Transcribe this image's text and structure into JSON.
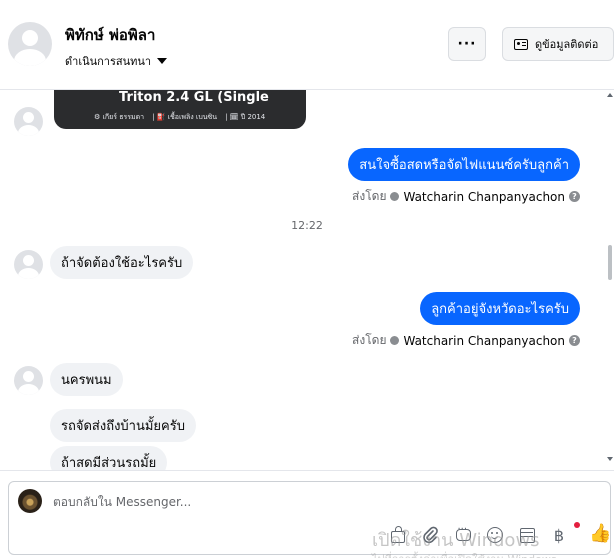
{
  "header": {
    "contact_name": "พิทักษ์ พ่อพิลา",
    "manage_chat_label": "ดำเนินการสนทนา",
    "more_label": "···",
    "contact_info_label": "ดูข้อมูลติดต่อ"
  },
  "messages": {
    "product_card": {
      "title": "Triton 2.4 GL (Single",
      "meta": [
        "⚙ เกียร์ ธรรมดา",
        "| ⛽ เชื้อเพลิง เบนซิน",
        "| 🗓 ปี 2014"
      ]
    },
    "out_1": "สนใจซื้อสดหรือจัดไฟแนนซ์ครับลูกค้า",
    "sent_by_prefix": "ส่งโดย",
    "sender_name": "Watcharin Chanpanyachon",
    "help_glyph": "?",
    "timestamp": "12:22",
    "in_1": "ถ้าจัดต้องใช้อะไรครับ",
    "out_2": "ลูกค้าอยู่จังหวัดอะไรครับ",
    "in_2": "นครพนม",
    "in_3": "รถจัดส่งถึงบ้านมั้ยครับ",
    "in_4": "ถ้าสดมีส่วนรถมั้ย"
  },
  "composer": {
    "placeholder": "ตอบกลับใน Messenger...",
    "icons": [
      "bag-icon",
      "paperclip-icon",
      "chat-icon",
      "smile-icon",
      "table-icon",
      "baht-icon",
      "like-icon"
    ]
  },
  "watermark": {
    "line1": "เปิดใช้งาน Windows",
    "line2": "ไปที่การตั้งค่าเพื่อเปิดใช้งาน Windows"
  },
  "colors": {
    "outgoing_bubble": "#0866ff",
    "incoming_bubble": "#f0f2f5",
    "secondary_text": "#65676b",
    "badge_red": "#e41e3f"
  }
}
